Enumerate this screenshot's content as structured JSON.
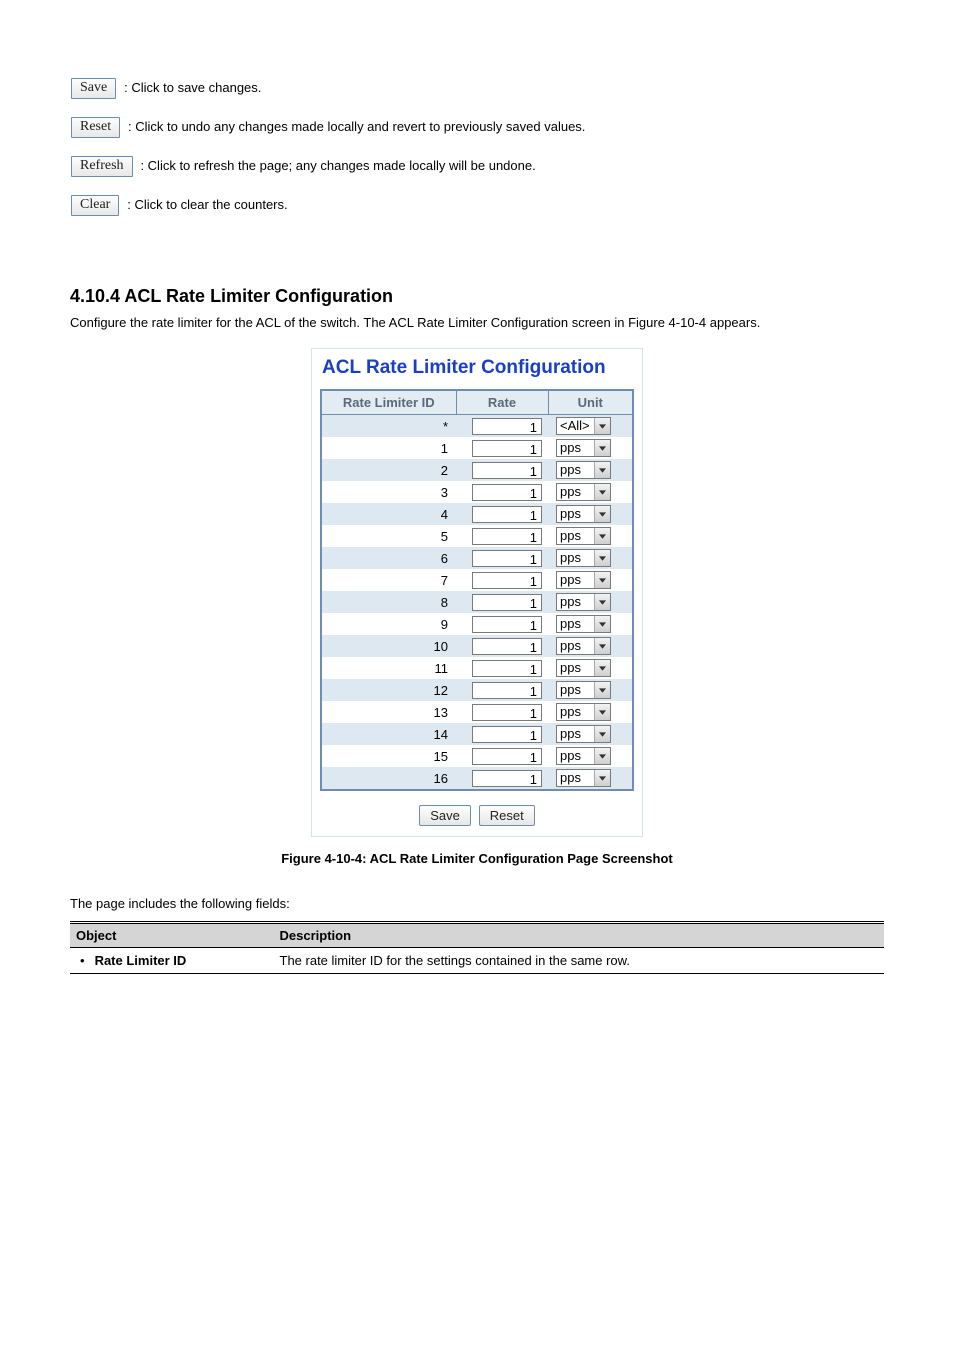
{
  "buttons_description": [
    {
      "label": "Save",
      "desc": ": Click to save changes."
    },
    {
      "label": "Reset",
      "desc": ": Click to undo any changes made locally and revert to previously saved values."
    },
    {
      "label": "Refresh",
      "desc": ": Click to refresh the page; any changes made locally will be undone."
    },
    {
      "label": "Clear",
      "desc": ": Click to clear the counters."
    }
  ],
  "section": {
    "number": "4.10.4 ACL Rate Limiter Configuration",
    "intro_prefix": "Configure the rate limiter for the ACL of the switch.",
    "intro_rest": " The ACL Rate Limiter Configuration screen in Figure 4-10-4 appears."
  },
  "panel": {
    "title": "ACL Rate Limiter Configuration",
    "headers": {
      "id": "Rate Limiter ID",
      "rate": "Rate",
      "unit": "Unit"
    },
    "rows": [
      {
        "id": "*",
        "rate": "1",
        "unit": "<All>"
      },
      {
        "id": "1",
        "rate": "1",
        "unit": "pps"
      },
      {
        "id": "2",
        "rate": "1",
        "unit": "pps"
      },
      {
        "id": "3",
        "rate": "1",
        "unit": "pps"
      },
      {
        "id": "4",
        "rate": "1",
        "unit": "pps"
      },
      {
        "id": "5",
        "rate": "1",
        "unit": "pps"
      },
      {
        "id": "6",
        "rate": "1",
        "unit": "pps"
      },
      {
        "id": "7",
        "rate": "1",
        "unit": "pps"
      },
      {
        "id": "8",
        "rate": "1",
        "unit": "pps"
      },
      {
        "id": "9",
        "rate": "1",
        "unit": "pps"
      },
      {
        "id": "10",
        "rate": "1",
        "unit": "pps"
      },
      {
        "id": "11",
        "rate": "1",
        "unit": "pps"
      },
      {
        "id": "12",
        "rate": "1",
        "unit": "pps"
      },
      {
        "id": "13",
        "rate": "1",
        "unit": "pps"
      },
      {
        "id": "14",
        "rate": "1",
        "unit": "pps"
      },
      {
        "id": "15",
        "rate": "1",
        "unit": "pps"
      },
      {
        "id": "16",
        "rate": "1",
        "unit": "pps"
      }
    ],
    "save_label": "Save",
    "reset_label": "Reset"
  },
  "figure_caption": "Figure 4-10-4: ACL Rate Limiter Configuration Page Screenshot",
  "obj_intro": "The page includes the following fields:",
  "obj_table": {
    "head_object": "Object",
    "head_desc": "Description",
    "rows": [
      {
        "object": "Rate Limiter ID",
        "desc": "The rate limiter ID for the settings contained in the same row."
      }
    ]
  }
}
